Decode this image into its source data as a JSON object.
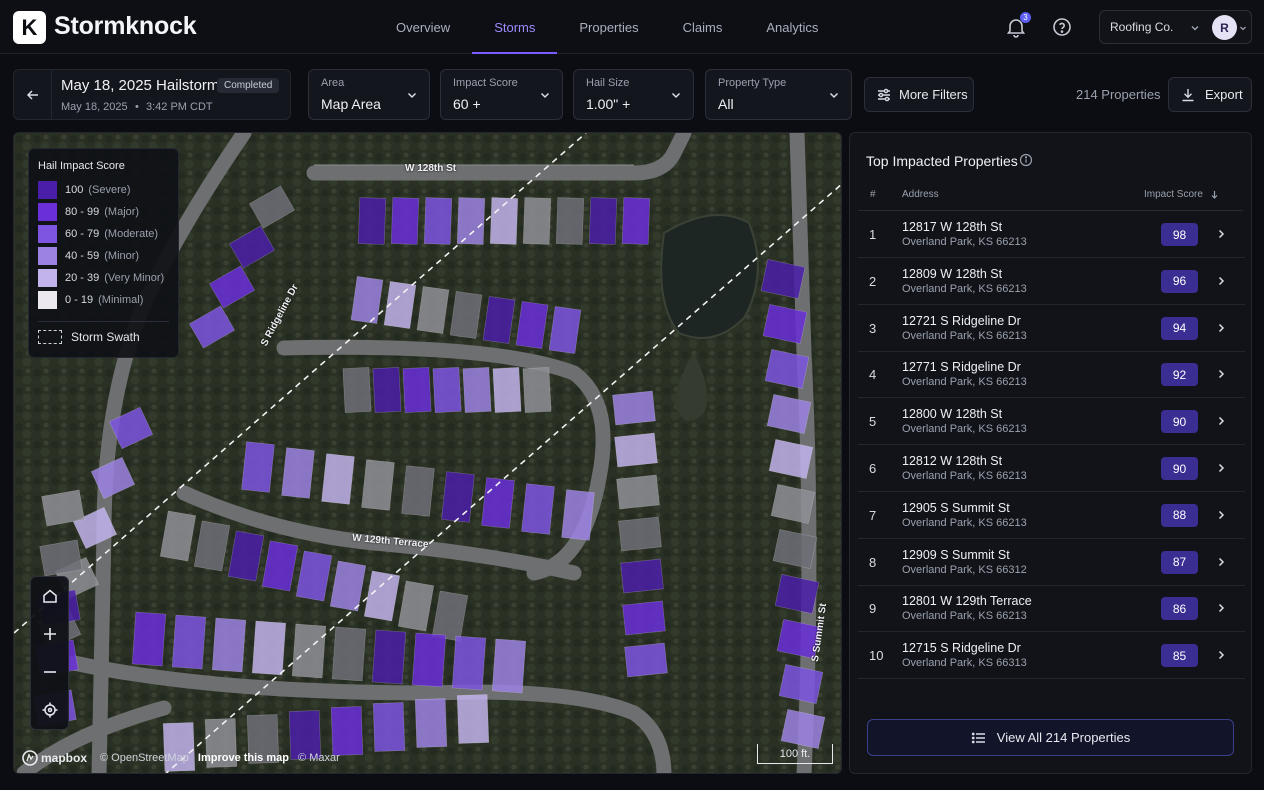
{
  "brand": {
    "logo_letter": "K",
    "name": "Stormknock"
  },
  "nav": {
    "items": [
      {
        "label": "Overview"
      },
      {
        "label": "Storms",
        "active": true
      },
      {
        "label": "Properties"
      },
      {
        "label": "Claims"
      },
      {
        "label": "Analytics"
      }
    ]
  },
  "header": {
    "notification_count": "3",
    "account_name": "Roofing Co.",
    "avatar_initial": "R"
  },
  "storm": {
    "title": "May 18, 2025 Hailstorm",
    "status": "Completed",
    "date": "May 18, 2025",
    "time": "3:42 PM CDT"
  },
  "filters": {
    "area": {
      "label": "Area",
      "value": "Map Area"
    },
    "impact": {
      "label": "Impact Score",
      "value": "60 +"
    },
    "hail": {
      "label": "Hail Size",
      "value": "1.00\" +"
    },
    "ptype": {
      "label": "Property Type",
      "value": "All"
    },
    "more": "More Filters",
    "count": "214 Properties",
    "export": "Export"
  },
  "legend": {
    "title": "Hail Impact Score",
    "rows": [
      {
        "range": "100",
        "desc": "(Severe)",
        "color": "#4a1ea8"
      },
      {
        "range": "80 - 99",
        "desc": "(Major)",
        "color": "#6a2fd8"
      },
      {
        "range": "60 - 79",
        "desc": "(Moderate)",
        "color": "#7d55e0"
      },
      {
        "range": "40 - 59",
        "desc": "(Minor)",
        "color": "#9c82e3"
      },
      {
        "range": "20 - 39",
        "desc": "(Very Minor)",
        "color": "#c2b3ec"
      },
      {
        "range": "0 - 19",
        "desc": "(Minimal)",
        "color": "#ebe8ef"
      }
    ],
    "swath": "Storm Swath"
  },
  "map": {
    "streets": {
      "w128": "W 128th St",
      "ridgeline": "S Ridgeline Dr",
      "w129": "W 129th Terrace",
      "summit": "S Summit St"
    },
    "attribution": {
      "mapbox": "mapbox",
      "osm": "© OpenStreetMap",
      "improve": "Improve this map",
      "maxar": "© Maxar"
    },
    "scale": "100 ft."
  },
  "panel": {
    "title": "Top Impacted Properties",
    "col_rank": "#",
    "col_address": "Address",
    "col_score": "Impact Score",
    "rows": [
      {
        "rank": "1",
        "address": "12817 W 128th St",
        "city": "Overland Park, KS 66213",
        "score": "98"
      },
      {
        "rank": "2",
        "address": "12809 W 128th St",
        "city": "Overland Park, KS 66213",
        "score": "96"
      },
      {
        "rank": "3",
        "address": "12721 S Ridgeline Dr",
        "city": "Overland Park, KS 66213",
        "score": "94"
      },
      {
        "rank": "4",
        "address": "12771 S Ridgeline Dr",
        "city": "Overland Park, KS 66213",
        "score": "92"
      },
      {
        "rank": "5",
        "address": "12800 W 128th St",
        "city": "Overland Park, KS 66213",
        "score": "90"
      },
      {
        "rank": "6",
        "address": "12812 W 128th St",
        "city": "Overland Park, KS 66213",
        "score": "90"
      },
      {
        "rank": "7",
        "address": "12905 S Summit St",
        "city": "Overland Park, KS 66213",
        "score": "88"
      },
      {
        "rank": "8",
        "address": "12909 S Summit St",
        "city": "Overland Park, KS 66312",
        "score": "87"
      },
      {
        "rank": "9",
        "address": "12801 W 129th Terrace",
        "city": "Overland Park, KS 66213",
        "score": "86"
      },
      {
        "rank": "10",
        "address": "12715 S Ridgeline Dr",
        "city": "Overland Park, KS 66313",
        "score": "85"
      }
    ],
    "view_all": "View All 214 Properties"
  }
}
